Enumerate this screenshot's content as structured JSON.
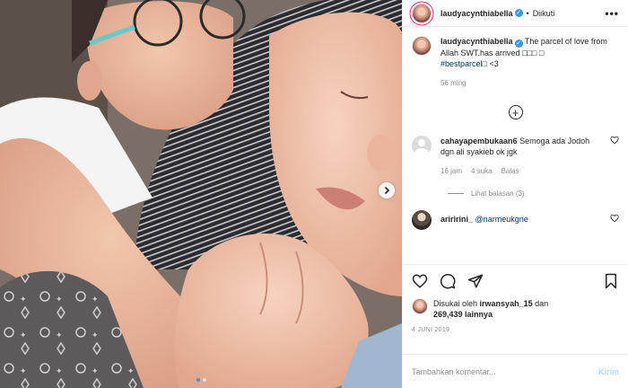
{
  "post": {
    "username": "laudyacynthiabella",
    "follow_status": "Diikuti",
    "bullet": "•",
    "more": "•••",
    "caption": {
      "username": "laudyacynthiabella",
      "text": "The parcel of love from Allah SWT.has arrived",
      "emoji": "□□□ □",
      "hashtag": "#bestparcel□",
      "suffix": "<3",
      "time": "56 ming"
    },
    "comments": [
      {
        "username": "cahayapembukaan6",
        "text": "Semoga ada Jodoh dgn ali syakieb ok jgk",
        "time": "16 jam",
        "likes": "4 suka",
        "reply": "Balas",
        "view_replies": "Lihat balasan (3)"
      },
      {
        "username": "ariririni_",
        "mention": "@narmeukgne"
      }
    ],
    "likes": {
      "prefix": "Disukai oleh",
      "user": "irwansyah_15",
      "conj": "dan",
      "count": "269,439 lainnya"
    },
    "date": "4 JUNI 2019",
    "comment_placeholder": "Tambahkan komentar...",
    "post_button": "Kirim",
    "colors": {
      "verified": "#3897f0",
      "link": "#00376b",
      "muted": "#8e8e8e",
      "post_button": "#b2dffc"
    },
    "icons": [
      "heart-icon",
      "comment-icon",
      "share-icon",
      "bookmark-icon",
      "add-circle-icon",
      "chevron-right-icon",
      "verified-icon"
    ]
  }
}
